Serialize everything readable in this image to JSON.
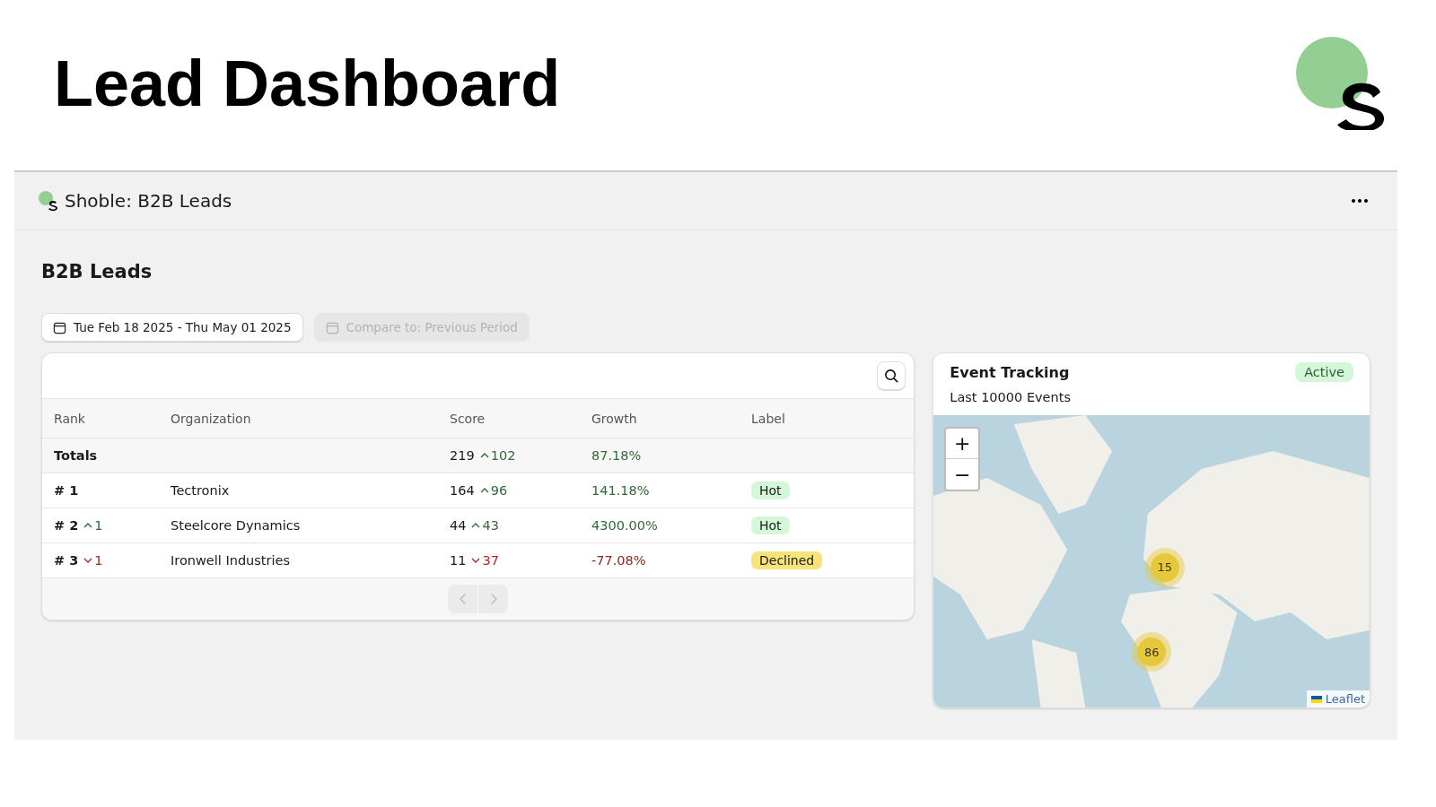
{
  "slide_title": "Lead Dashboard",
  "app": {
    "title": "Shoble: B2B Leads",
    "page_title": "B2B Leads",
    "date_range": "Tue Feb 18 2025 - Thu May 01 2025",
    "compare": {
      "label": "Compare to: Previous Period",
      "disabled": true
    },
    "table": {
      "columns": [
        "Rank",
        "Organization",
        "Score",
        "Growth",
        "Label"
      ],
      "totals": {
        "label": "Totals",
        "score": "219",
        "score_change": {
          "value": "102",
          "kind": "up"
        },
        "growth": "87.18%",
        "growth_negative": false
      },
      "rows": [
        {
          "rank": "# 1",
          "rank_change": null,
          "organization": "Tectronix",
          "score": "164",
          "score_change": {
            "value": "96",
            "kind": "up"
          },
          "growth": "141.18%",
          "growth_negative": false,
          "label": {
            "text": "Hot",
            "color": "#d3f8d9"
          }
        },
        {
          "rank": "# 2",
          "rank_change": {
            "value": "1",
            "kind": "up"
          },
          "organization": "Steelcore Dynamics",
          "score": "44",
          "score_change": {
            "value": "43",
            "kind": "up"
          },
          "growth": "4300.00%",
          "growth_negative": false,
          "label": {
            "text": "Hot",
            "color": "#d3f8d9"
          }
        },
        {
          "rank": "# 3",
          "rank_change": {
            "value": "1",
            "kind": "down"
          },
          "organization": "Ironwell Industries",
          "score": "11",
          "score_change": {
            "value": "37",
            "kind": "down"
          },
          "growth": "-77.08%",
          "growth_negative": true,
          "label": {
            "text": "Declined",
            "color": "#f6e47a"
          }
        }
      ]
    },
    "events": {
      "title": "Event Tracking",
      "status": "Active",
      "subtitle": "Last 10000 Events",
      "map": {
        "zoom_in": "+",
        "zoom_out": "−",
        "clusters": [
          "15",
          "86"
        ],
        "attribution": "Leaflet"
      }
    }
  }
}
